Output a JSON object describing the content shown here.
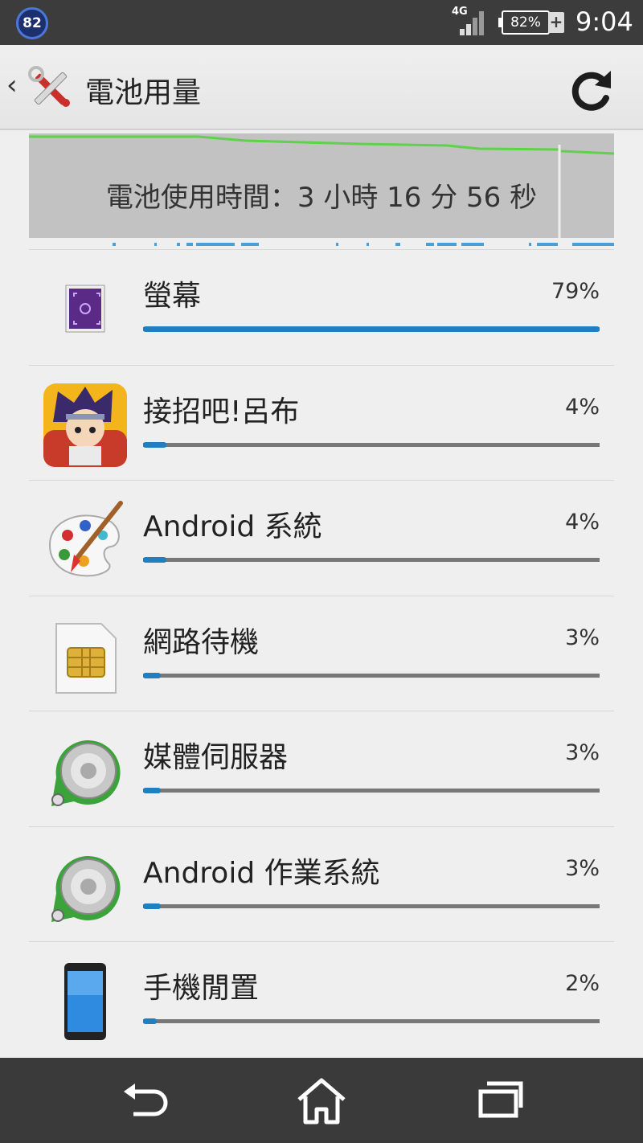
{
  "status": {
    "notif_count": "82",
    "network": "4G",
    "battery": "82%",
    "time": "9:04"
  },
  "header": {
    "title": "電池用量"
  },
  "graph": {
    "text": "電池使用時間：3 小時 16 分 56 秒"
  },
  "items": [
    {
      "label": "螢幕",
      "pct": "79%",
      "value": 0.79,
      "icon": "screen-icon"
    },
    {
      "label": "接招吧!呂布",
      "pct": "4%",
      "value": 0.04,
      "icon": "game-app-icon"
    },
    {
      "label": "Android 系統",
      "pct": "4%",
      "value": 0.04,
      "icon": "palette-icon"
    },
    {
      "label": "網路待機",
      "pct": "3%",
      "value": 0.03,
      "icon": "sim-card-icon"
    },
    {
      "label": "媒體伺服器",
      "pct": "3%",
      "value": 0.03,
      "icon": "media-server-icon"
    },
    {
      "label": "Android 作業系統",
      "pct": "3%",
      "value": 0.03,
      "icon": "media-server-icon"
    },
    {
      "label": "手機閒置",
      "pct": "2%",
      "value": 0.02,
      "icon": "phone-icon"
    }
  ],
  "colors": {
    "accent": "#1f7fc1",
    "graph_line": "#5fd14a"
  }
}
